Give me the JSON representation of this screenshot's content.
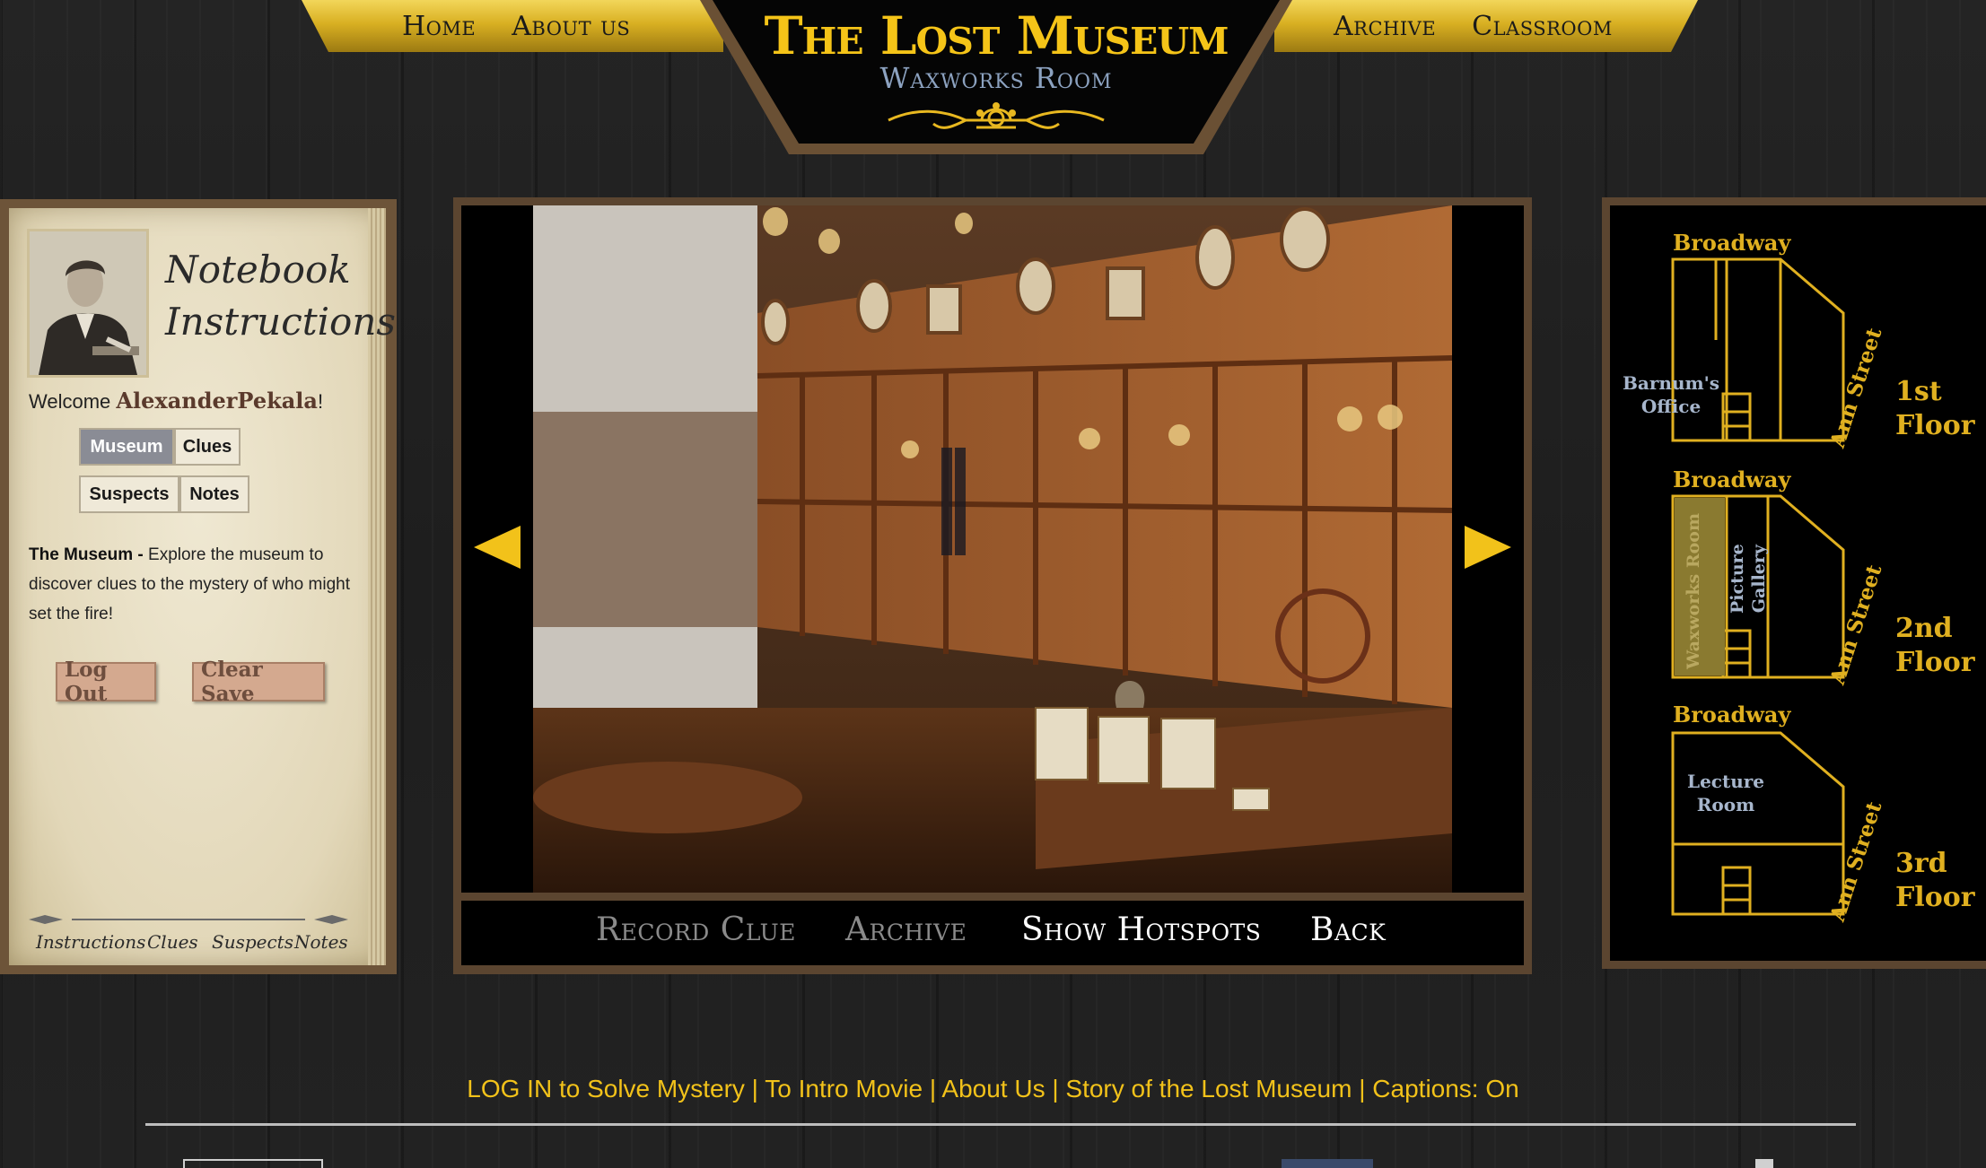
{
  "nav": {
    "home": "Home",
    "about": "About us",
    "archive": "Archive",
    "classroom": "Classroom"
  },
  "header": {
    "site_title": "The Lost Museum",
    "room_title": "Waxworks Room"
  },
  "notebook": {
    "title_line1": "Notebook",
    "title_line2": "Instructions",
    "welcome_prefix": "Welcome ",
    "username": "AlexanderPekala",
    "welcome_suffix": "!",
    "tabs": {
      "museum": "Museum",
      "clues": "Clues",
      "suspects": "Suspects",
      "notes": "Notes"
    },
    "desc_heading": "The Museum - ",
    "desc_body": "Explore the museum to discover clues to the mystery of who might set the fire!",
    "logout": "Log Out",
    "clear_save": "Clear Save",
    "footer": {
      "instructions": "Instructions",
      "clues": "Clues",
      "suspects": "Suspects",
      "notes": "Notes"
    }
  },
  "viewer": {
    "record_clue": "Record Clue",
    "archive": "Archive",
    "show_hotspots": "Show Hotspots",
    "back": "Back"
  },
  "map": {
    "broadway": "Broadway",
    "ann_street": "Ann Street",
    "floor1": {
      "num": "1st",
      "label": "Floor",
      "room_line1": "Barnum's",
      "room_line2": "Office"
    },
    "floor2": {
      "num": "2nd",
      "label": "Floor",
      "room_a": "Waxworks Room",
      "room_b_line1": "Picture",
      "room_b_line2": "Gallery"
    },
    "floor3": {
      "num": "3rd",
      "label": "Floor",
      "room_line1": "Lecture",
      "room_line2": "Room"
    }
  },
  "footer": {
    "login": "LOG IN to Solve Mystery",
    "intro": "To Intro Movie",
    "about": "About Us",
    "story": "Story of the Lost Museum",
    "captions": "Captions: On",
    "sep": " | "
  },
  "colors": {
    "accent_gold": "#f2c21a",
    "frame_brown": "#5b4530",
    "active_tab": "#8a8c95",
    "map_highlight": "#8a7a30"
  }
}
